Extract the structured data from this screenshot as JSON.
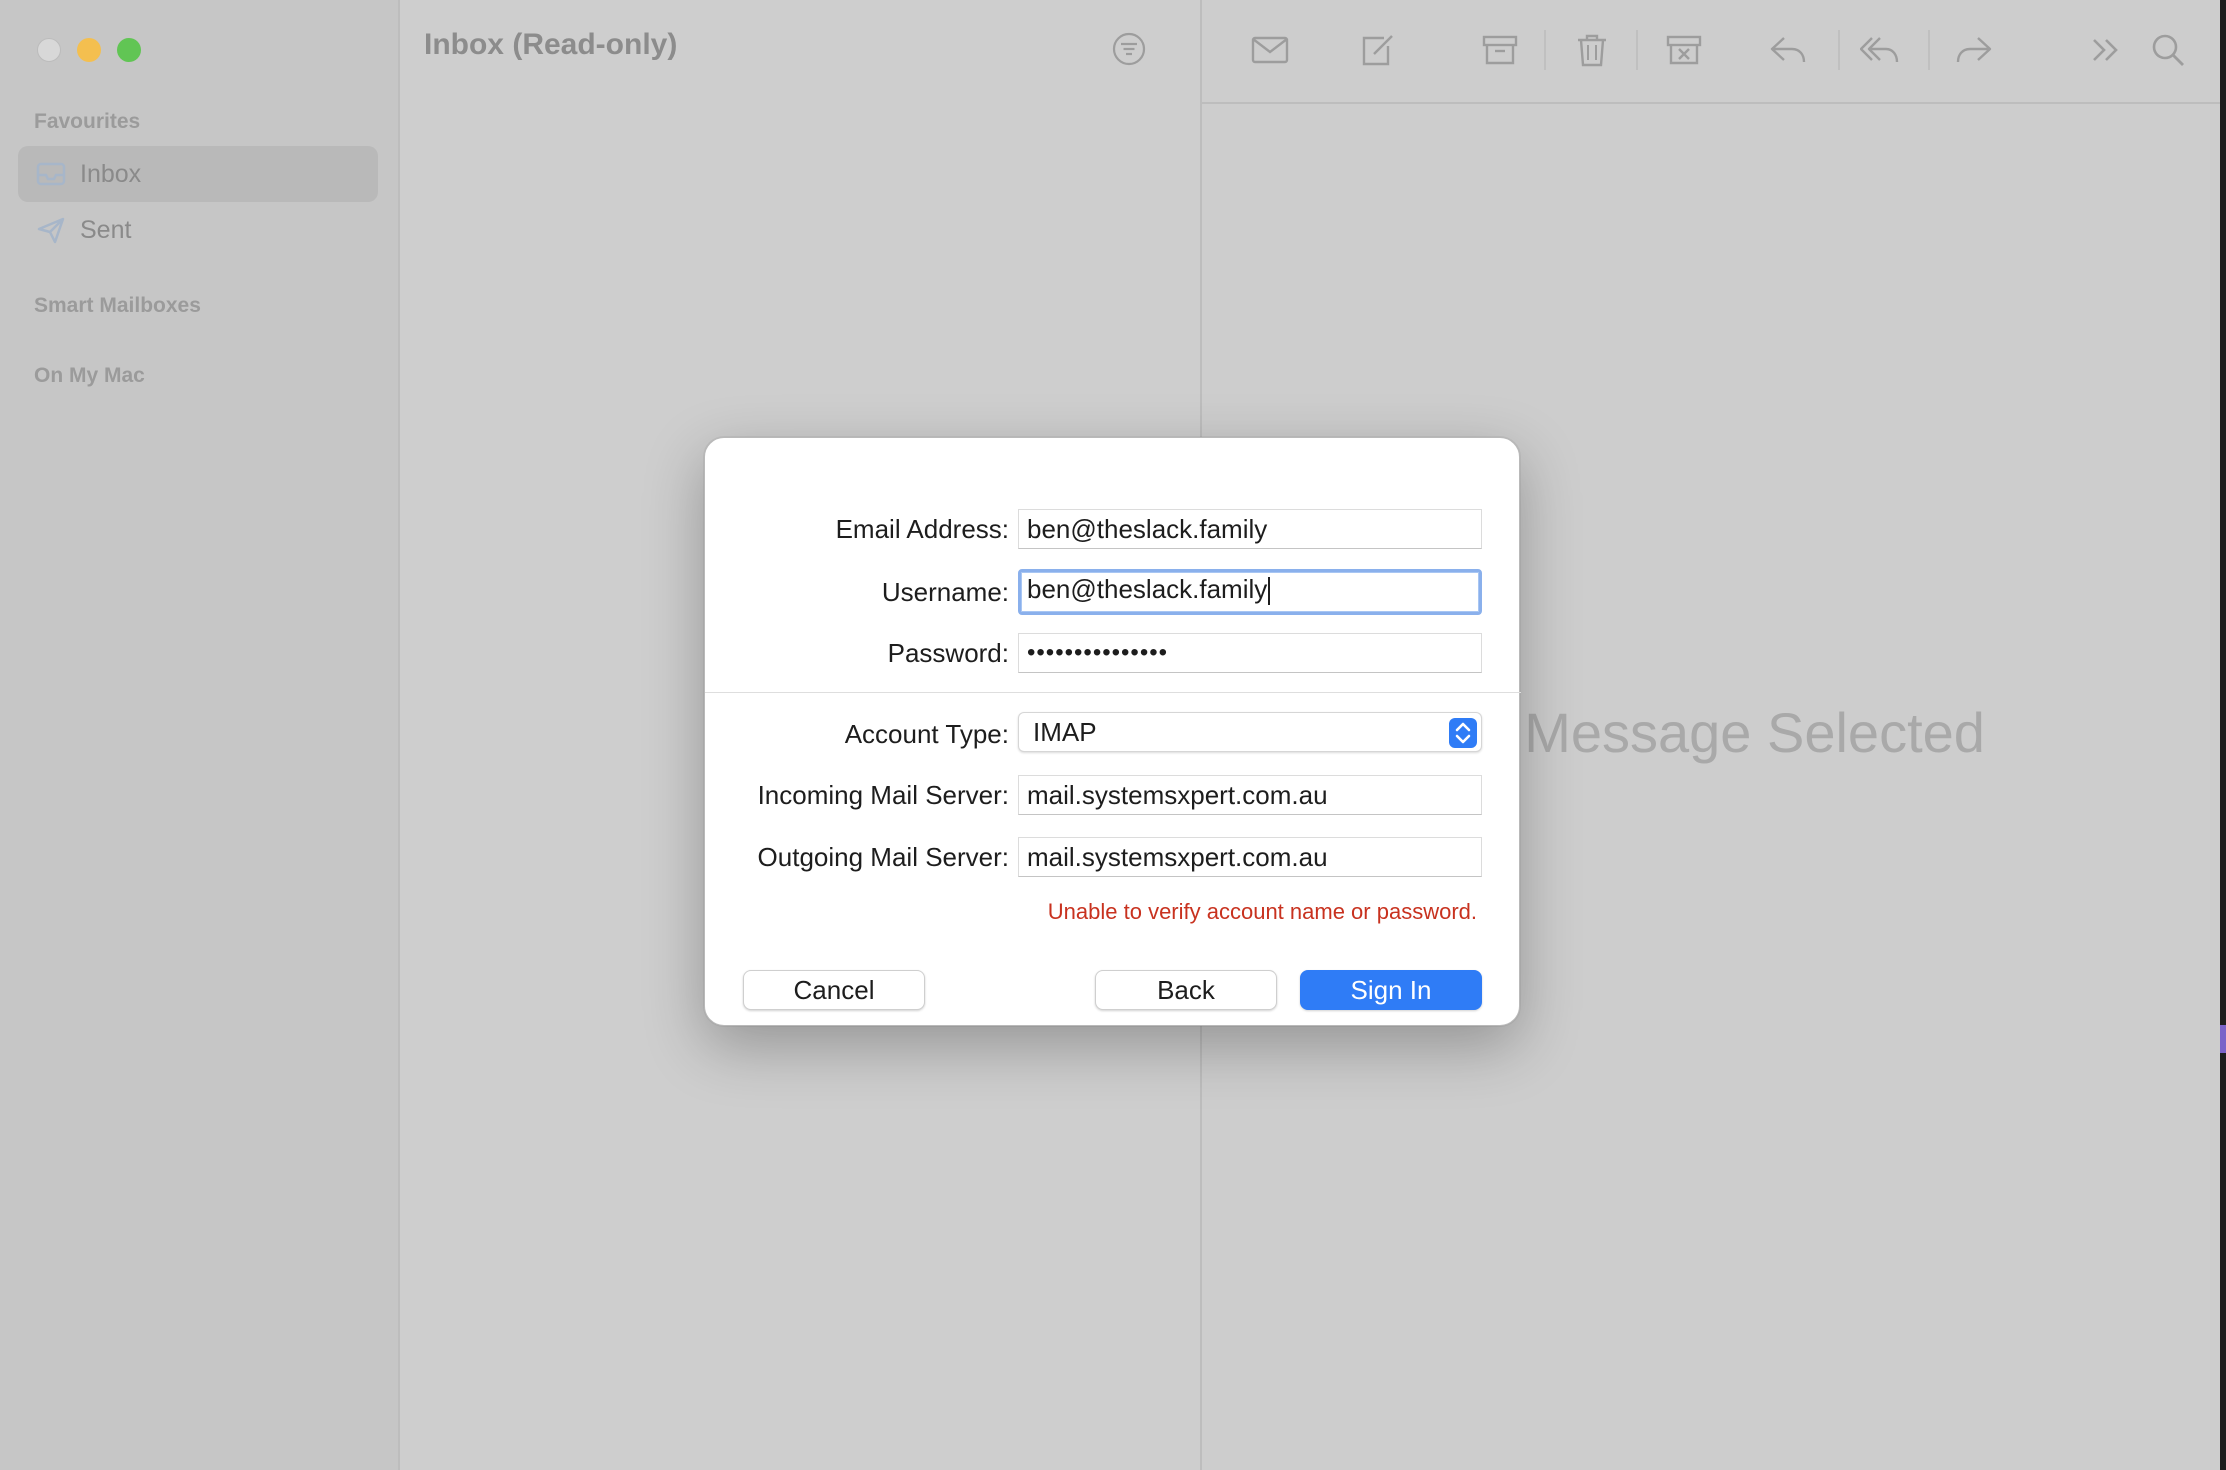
{
  "window": {
    "accent_color": "#2f7cf6"
  },
  "sidebar": {
    "favourites_header": "Favourites",
    "items": [
      {
        "label": "Inbox",
        "icon": "inbox-icon",
        "selected": true
      },
      {
        "label": "Sent",
        "icon": "paper-plane-icon",
        "selected": false
      }
    ],
    "smart_mailboxes_header": "Smart Mailboxes",
    "on_my_mac_header": "On My Mac"
  },
  "list_pane": {
    "title": "Inbox (Read-only)",
    "filter_icon": "filter-icon"
  },
  "toolbar": {
    "icons": [
      "envelope-icon",
      "compose-icon",
      "archive-icon",
      "trash-icon",
      "junk-icon",
      "reply-icon",
      "reply-all-icon",
      "forward-icon",
      "more-icon",
      "search-icon"
    ]
  },
  "message_pane": {
    "empty_text": "No Message Selected"
  },
  "dialog": {
    "email_label": "Email Address:",
    "email_value": "ben@theslack.family",
    "username_label": "Username:",
    "username_value": "ben@theslack.family",
    "password_label": "Password:",
    "password_value": "•••••••••••••••",
    "account_type_label": "Account Type:",
    "account_type_value": "IMAP",
    "incoming_label": "Incoming Mail Server:",
    "incoming_value": "mail.systemsxpert.com.au",
    "outgoing_label": "Outgoing Mail Server:",
    "outgoing_value": "mail.systemsxpert.com.au",
    "error_text": "Unable to verify account name or password.",
    "error_color": "#c8321f",
    "cancel_label": "Cancel",
    "back_label": "Back",
    "signin_label": "Sign In"
  }
}
